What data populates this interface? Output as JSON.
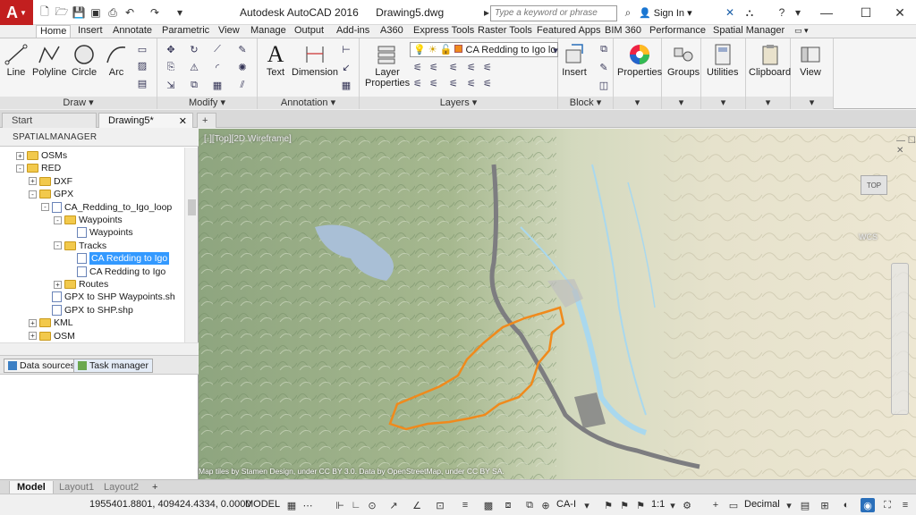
{
  "app": {
    "title": "Autodesk AutoCAD 2016",
    "document": "Drawing5.dwg",
    "logo_letter": "A",
    "search_placeholder": "Type a keyword or phrase",
    "signin": "Sign In"
  },
  "ribbon_tabs": [
    "Home",
    "Insert",
    "Annotate",
    "Parametric",
    "View",
    "Manage",
    "Output",
    "Add-ins",
    "A360",
    "Express Tools",
    "Raster Tools",
    "Featured Apps",
    "BIM 360",
    "Performance",
    "Spatial Manager"
  ],
  "ribbon": {
    "draw_panel": "Draw",
    "modify_panel": "Modify",
    "annotation_panel": "Annotation",
    "layers_panel": "Layers",
    "block_panel": "Block",
    "tools": {
      "line": "Line",
      "polyline": "Polyline",
      "circle": "Circle",
      "arc": "Arc",
      "text": "Text",
      "dimension": "Dimension",
      "layer_properties_1": "Layer",
      "layer_properties_2": "Properties",
      "insert": "Insert",
      "properties": "Properties",
      "groups": "Groups",
      "utilities": "Utilities",
      "clipboard": "Clipboard",
      "view": "View"
    },
    "layer_current": "CA Redding to Igo lo"
  },
  "file_tabs": {
    "start": "Start",
    "drawing": "Drawing5*"
  },
  "spatial_manager": {
    "title": "SPATIALMANAGER",
    "tree": [
      {
        "label": "OSMs",
        "indent": 1,
        "kind": "folder",
        "pm": "+"
      },
      {
        "label": "RED",
        "indent": 1,
        "kind": "folder",
        "pm": "-"
      },
      {
        "label": "DXF",
        "indent": 2,
        "kind": "folder",
        "pm": "+"
      },
      {
        "label": "GPX",
        "indent": 2,
        "kind": "folder",
        "pm": "-"
      },
      {
        "label": "CA_Redding_to_Igo_loop",
        "indent": 3,
        "kind": "doc",
        "pm": "-"
      },
      {
        "label": "Waypoints",
        "indent": 4,
        "kind": "folder",
        "pm": "-"
      },
      {
        "label": "Waypoints",
        "indent": 5,
        "kind": "doc",
        "pm": ""
      },
      {
        "label": "Tracks",
        "indent": 4,
        "kind": "folder",
        "pm": "-"
      },
      {
        "label": "CA Redding to Igo",
        "indent": 5,
        "kind": "doc",
        "pm": "",
        "selected": true
      },
      {
        "label": "CA Redding to Igo",
        "indent": 5,
        "kind": "doc",
        "pm": ""
      },
      {
        "label": "Routes",
        "indent": 4,
        "kind": "folder",
        "pm": "+"
      },
      {
        "label": "GPX to SHP Waypoints.sh",
        "indent": 3,
        "kind": "doc",
        "pm": ""
      },
      {
        "label": "GPX to SHP.shp",
        "indent": 3,
        "kind": "doc",
        "pm": ""
      },
      {
        "label": "KML",
        "indent": 2,
        "kind": "folder",
        "pm": "+"
      },
      {
        "label": "OSM",
        "indent": 2,
        "kind": "folder",
        "pm": "+"
      }
    ],
    "tabs": {
      "data_sources": "Data sources",
      "task_manager": "Task manager"
    }
  },
  "map": {
    "viewport_label": "[-][Top][2D Wireframe]",
    "attribution": "Map tiles by Stamen Design, under CC BY 3.0. Data by OpenStreetMap, under CC BY SA.",
    "viewcube_top": "TOP",
    "wcs": "WCS",
    "colors": {
      "track": "#f08a1c",
      "water": "#a9d8ee",
      "urban": "#7d7d80"
    }
  },
  "layout_tabs": [
    "Model",
    "Layout1",
    "Layout2"
  ],
  "status": {
    "coords": "1955401.8801, 409424.4334, 0.0000",
    "model": "MODEL",
    "coord_system": "CA-I",
    "scale": "1:1",
    "units": "Decimal"
  }
}
